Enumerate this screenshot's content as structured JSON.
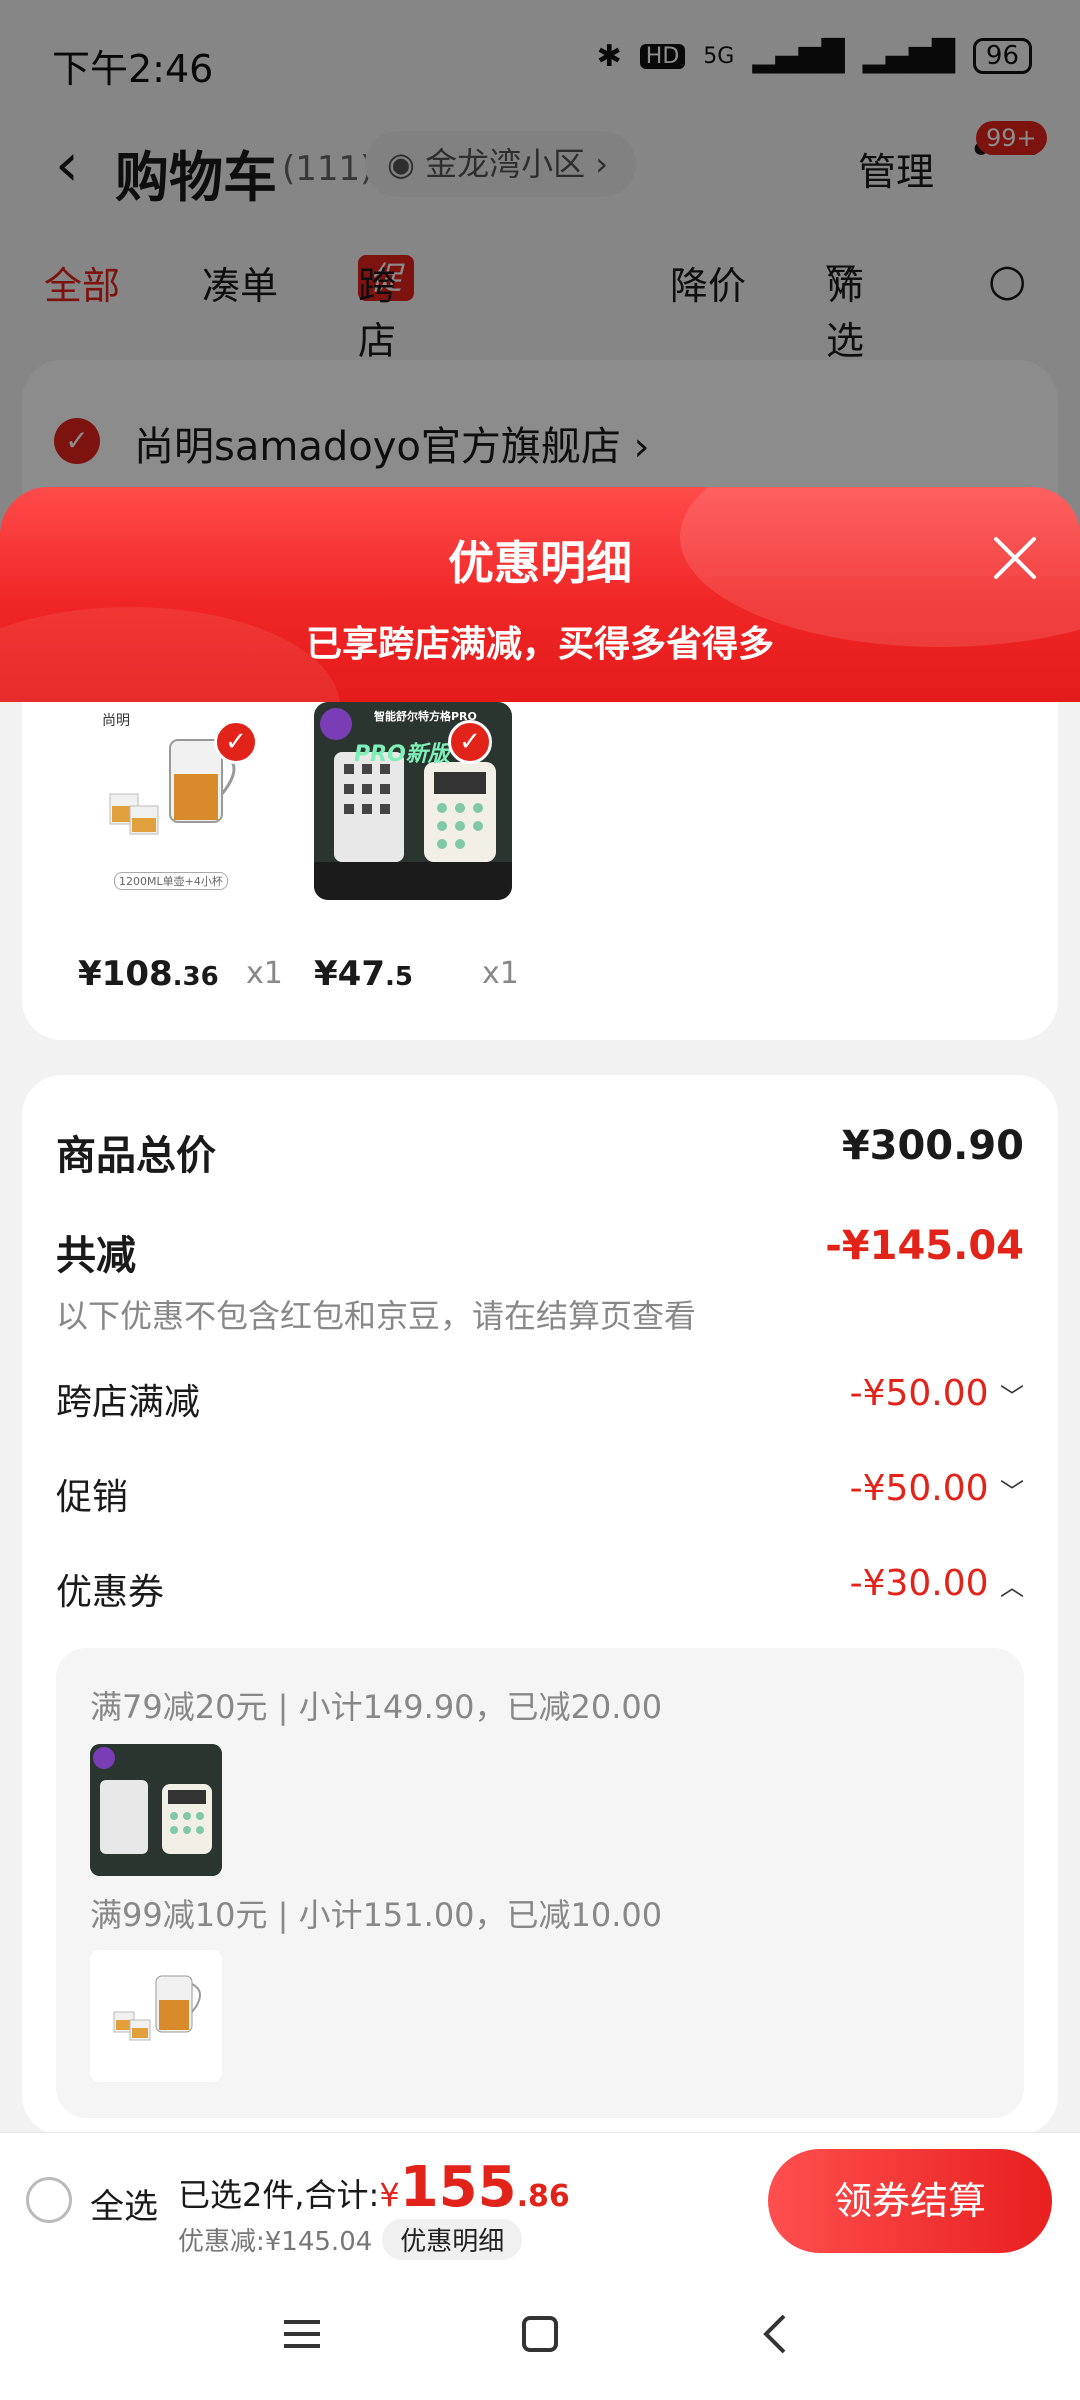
{
  "status_bar": {
    "time": "下午2:46",
    "network": "5G",
    "hd": "HD",
    "battery": "96"
  },
  "header": {
    "title": "购物车",
    "count": "(111)",
    "location": "金龙湾小区",
    "manage": "管理",
    "badge": "99+"
  },
  "tabs": [
    {
      "label": "全部",
      "active": true
    },
    {
      "label": "凑单"
    },
    {
      "label": "跨店满减",
      "tag": "促"
    },
    {
      "label": "降价"
    },
    {
      "label": "筛选"
    }
  ],
  "shop": {
    "name": "尚明samadoyo官方旗舰店"
  },
  "sheet": {
    "title": "优惠明细",
    "subtitle": "已享跨店满减，买得多省得多"
  },
  "products": [
    {
      "price_main": "¥108",
      "price_cents": ".36",
      "qty": "x1",
      "img_caption": "1200ML单壶+4小杯",
      "brand": "尚明"
    },
    {
      "price_main": "¥47",
      "price_cents": ".5",
      "qty": "x1",
      "img_caption": "智能舒尔特方格PRO",
      "tag": "PRO新版"
    }
  ],
  "summary": {
    "total_label": "商品总价",
    "total_value": "¥300.90",
    "reduce_label": "共减",
    "reduce_value": "-¥145.04",
    "note": "以下优惠不包含红包和京豆，请在结算页查看",
    "items": [
      {
        "label": "跨店满减",
        "value": "-¥50.00",
        "chevron": "﹀"
      },
      {
        "label": "促销",
        "value": "-¥50.00",
        "chevron": "﹀"
      },
      {
        "label": "优惠券",
        "value": "-¥30.00",
        "chevron": "︿"
      }
    ],
    "coupons": [
      {
        "line": "满79减20元 | 小计149.90，已减20.00"
      },
      {
        "line": "满99减10元 | 小计151.00，已减10.00"
      }
    ]
  },
  "bottom_bar": {
    "select_all": "全选",
    "selected_text": "已选2件,合计:",
    "currency": "¥",
    "total_int": "155",
    "total_cents": ".86",
    "discount_text": "优惠减:¥145.04",
    "detail_btn": "优惠明细",
    "checkout_btn": "领券结算"
  },
  "colors": {
    "accent": "#e2231a",
    "sheet_gradient_start": "#ff4b4b"
  }
}
